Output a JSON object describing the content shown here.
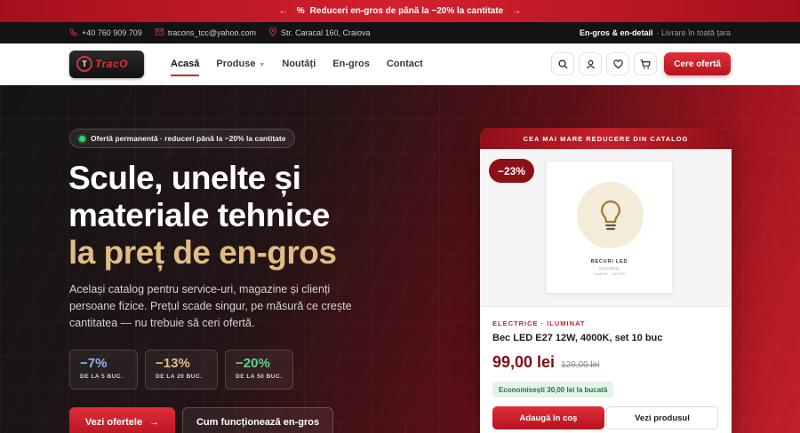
{
  "promo": {
    "arrow_left": "←",
    "icon": "%",
    "text": "Reduceri en-gros de până la −20% la cantitate",
    "arrow_right": "→"
  },
  "contact": {
    "phone": "+40 760 909 709",
    "email": "tracons_tcc@yahoo.com",
    "address": "Str. Caracal 160, Craiova",
    "mode": "En-gros & en-detail",
    "delivery": "· Livrare în toată țara"
  },
  "nav": {
    "logo_text": "TracO",
    "items": [
      {
        "label": "Acasă"
      },
      {
        "label": "Produse"
      },
      {
        "label": "Noutăți"
      },
      {
        "label": "En-gros"
      },
      {
        "label": "Contact"
      }
    ],
    "cta": "Cere ofertă",
    "icons": [
      "search-icon",
      "user-icon",
      "heart-icon",
      "cart-icon"
    ]
  },
  "hero": {
    "badge": "Ofertă permanentă · reduceri până la −20% la cantitate",
    "title_line1": "Scule, unelte și",
    "title_line2": "materiale tehnice",
    "title_line3": "la preț de en-gros",
    "lead": "Același catalog pentru service-uri, magazine și clienți persoane fizice. Prețul scade singur, pe măsură ce crește cantitatea — nu trebuie să ceri ofertă.",
    "stats": [
      {
        "value": "−7%",
        "label": "DE LA 5 BUC.",
        "color": "#8fb4f0"
      },
      {
        "value": "−13%",
        "label": "DE LA 20 BUC.",
        "color": "#e0bd83"
      },
      {
        "value": "−20%",
        "label": "DE LA 50 BUC.",
        "color": "#5fd28a"
      }
    ],
    "btn_primary": "Vezi ofertele",
    "btn_primary_arrow": "→",
    "btn_secondary": "Cum funcționează en-gros"
  },
  "card": {
    "header": "CEA MAI MARE REDUCERE DIN CATALOG",
    "discount": "−23%",
    "pkg_title": "BECURI LED",
    "pkg_sub": "ELECTRICE",
    "pkg_small": "ILUMINAT · CALITATE",
    "category": "ELECTRICE · ILUMINAT",
    "name": "Bec LED E27 12W, 4000K, set 10 buc",
    "price": "99,00 lei",
    "old_price": "129,00 lei",
    "savings": "Economisești 30,00 lei la bucată",
    "add_to_cart": "Adaugă în coș",
    "view_product": "Vezi produsul"
  },
  "colors": {
    "brand": "#d4202e",
    "dark_red": "#8d0f18",
    "gold": "#e0bd83",
    "green": "#33d36b"
  }
}
